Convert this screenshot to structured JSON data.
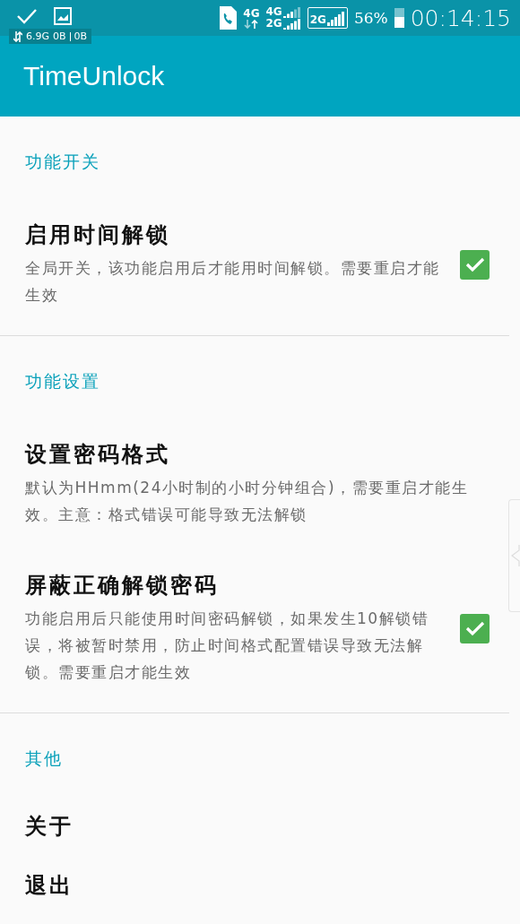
{
  "status_bar": {
    "notification_icons": [
      {
        "kind": "check"
      },
      {
        "kind": "image"
      }
    ],
    "traffic": {
      "total": "6.9G",
      "down": "0B",
      "up": "0B"
    },
    "networks": [
      {
        "kind": "data",
        "labels": [
          "4G"
        ]
      },
      {
        "kind": "dual",
        "labels": [
          "4G",
          "2G"
        ]
      },
      {
        "kind": "boxed",
        "labels": [
          "2G"
        ]
      }
    ],
    "battery": {
      "percent": "56%",
      "level": 0.56
    },
    "time": "00:14:15"
  },
  "app_bar": {
    "title": "TimeUnlock"
  },
  "sections": [
    {
      "title": "功能开关",
      "items": [
        {
          "kind": "checkbox",
          "title": "启用时间解锁",
          "summary": "全局开关，该功能启用后才能用时间解锁。需要重启才能生效",
          "checked": true
        }
      ]
    },
    {
      "title": "功能设置",
      "items": [
        {
          "kind": "plain",
          "title": "设置密码格式",
          "summary": "默认为HHmm(24小时制的小时分钟组合)，需要重启才能生效。主意：格式错误可能导致无法解锁"
        },
        {
          "kind": "checkbox",
          "title": "屏蔽正确解锁密码",
          "summary": "功能启用后只能使用时间密码解锁，如果发生10解锁错误，将被暂时禁用，防止时间格式配置错误导致无法解锁。需要重启才能生效",
          "checked": true
        }
      ]
    },
    {
      "title": "其他",
      "items": [
        {
          "kind": "plain",
          "title": "关于"
        },
        {
          "kind": "plain",
          "title": "退出"
        }
      ]
    }
  ]
}
